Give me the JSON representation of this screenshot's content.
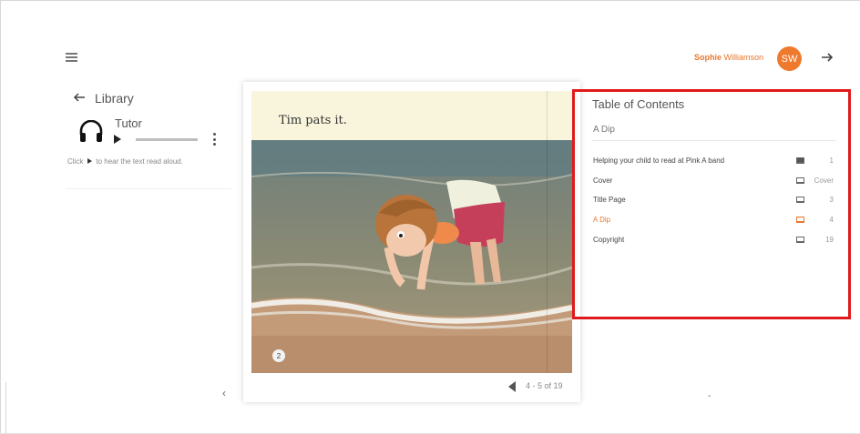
{
  "header": {
    "user_first": "Sophie",
    "user_last": "Williamson",
    "avatar_initials": "SW"
  },
  "sidebar": {
    "back_label": "Library",
    "tutor_label": "Tutor",
    "hint_prefix": "Click",
    "hint_suffix": "to hear the text read aloud."
  },
  "book": {
    "page_text": "Tim pats it.",
    "page_number": "2",
    "nav_label": "4 - 5 of 19"
  },
  "toc": {
    "title": "Table of Contents",
    "current": "A Dip",
    "items": [
      {
        "label": "Helping your child to read at Pink A band",
        "page": "1",
        "icon": "book-icon"
      },
      {
        "label": "Cover",
        "page": "Cover",
        "icon": "laptop-icon"
      },
      {
        "label": "Title Page",
        "page": "3",
        "icon": "laptop-icon"
      },
      {
        "label": "A Dip",
        "page": "4",
        "icon": "laptop-icon",
        "active": true
      },
      {
        "label": "Copyright",
        "page": "19",
        "icon": "laptop-icon"
      }
    ]
  },
  "colors": {
    "accent": "#ef7a2d",
    "highlight_border": "#e01a1a"
  }
}
